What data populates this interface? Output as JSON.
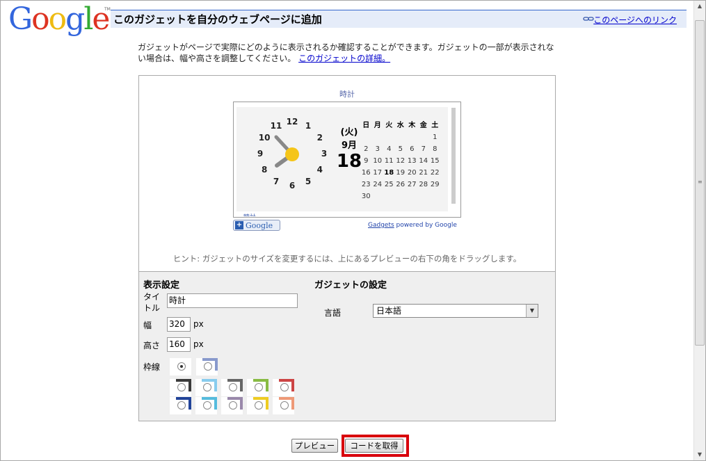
{
  "header": {
    "logo_text": "Google",
    "logo_tm": "TM",
    "title": "このガジェットを自分のウェブページに追加",
    "link_label": "このページへのリンク",
    "link_icon": "chain-link-icon"
  },
  "intro": {
    "text": "ガジェットがページで実際にどのように表示されるか確認することができます。ガジェットの一部が表示されない場合は、幅や高さを調整してください。",
    "details_link": "このガジェットの詳細。"
  },
  "gadget": {
    "title": "時計",
    "clock_numbers": [
      "12",
      "1",
      "2",
      "3",
      "4",
      "5",
      "6",
      "7",
      "8",
      "9",
      "10",
      "11"
    ],
    "day_of_week": "(火)",
    "month": "9月",
    "day": "18",
    "cal_headers": [
      "日",
      "月",
      "火",
      "水",
      "木",
      "金",
      "土"
    ],
    "cal_rows": [
      [
        "",
        "",
        "",
        "",
        "",
        "",
        "1"
      ],
      [
        "2",
        "3",
        "4",
        "5",
        "6",
        "7",
        "8"
      ],
      [
        "9",
        "10",
        "11",
        "12",
        "13",
        "14",
        "15"
      ],
      [
        "16",
        "17",
        "18",
        "19",
        "20",
        "21",
        "22"
      ],
      [
        "23",
        "24",
        "25",
        "26",
        "27",
        "28",
        "29"
      ],
      [
        "30",
        "",
        "",
        "",
        "",
        "",
        ""
      ]
    ],
    "today": "18",
    "clipped_label": "時計",
    "add_button_label": "Google",
    "powered_link": "Gadgets",
    "powered_text": " powered by Google",
    "hint": "ヒント: ガジェットのサイズを変更するには、上にあるプレビューの右下の角をドラッグします。"
  },
  "display_settings": {
    "heading": "表示設定",
    "title_label": "タイトル",
    "title_value": "時計",
    "width_label": "幅",
    "width_value": "320",
    "width_unit": "px",
    "height_label": "高さ",
    "height_value": "160",
    "height_unit": "px",
    "border_label": "枠線",
    "border_colors": [
      "#3b3b3b",
      "#88ccee",
      "#666666",
      "#88bb44",
      "#cc4444",
      "#224499",
      "#55bbdd",
      "#9988aa",
      "#eecc22",
      "#ee9977"
    ]
  },
  "gadget_settings": {
    "heading": "ガジェットの設定",
    "language_label": "言語",
    "language_value": "日本語"
  },
  "buttons": {
    "preview": "プレビュー",
    "get_code": "コードを取得"
  },
  "colors": {
    "header_bg": "#e5ecf9",
    "link": "#0000cc",
    "highlight": "#d8000c"
  }
}
